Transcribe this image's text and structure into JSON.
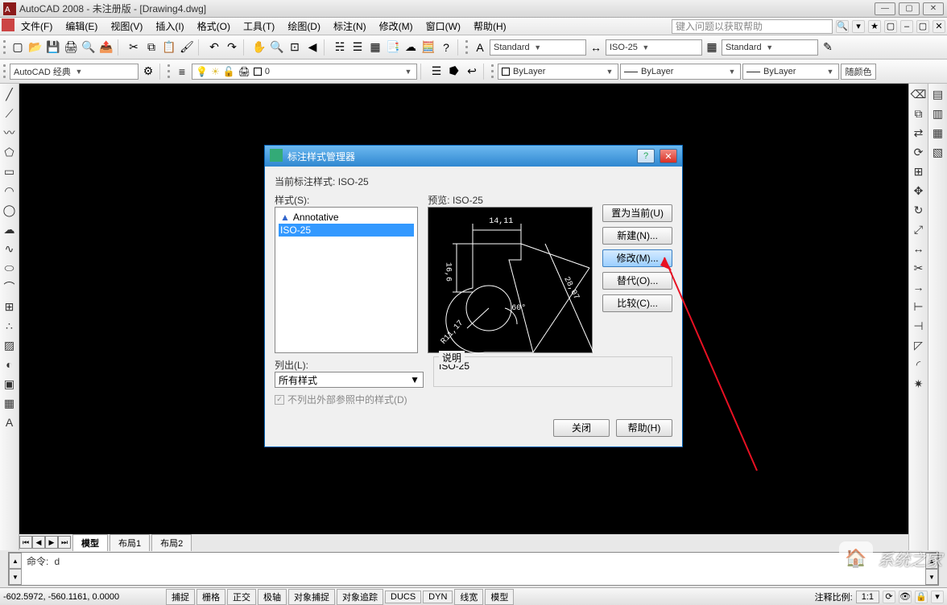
{
  "titlebar": {
    "title": "AutoCAD 2008 - 未注册版 - [Drawing4.dwg]"
  },
  "menu": {
    "items": [
      "文件(F)",
      "编辑(E)",
      "视图(V)",
      "插入(I)",
      "格式(O)",
      "工具(T)",
      "绘图(D)",
      "标注(N)",
      "修改(M)",
      "窗口(W)",
      "帮助(H)"
    ],
    "help_placeholder": "键入问题以获取帮助"
  },
  "toolbar1": {
    "workspace": "AutoCAD 经典",
    "layer": "0"
  },
  "toolbar2": {
    "std1": "Standard",
    "iso": "ISO-25",
    "std2": "Standard",
    "bylayer1": "ByLayer",
    "bylayer2": "ByLayer",
    "bylayer3": "ByLayer",
    "colorbtn": "随颜色"
  },
  "canvas_tabs": {
    "tabs": [
      "模型",
      "布局1",
      "布局2"
    ],
    "active": 0
  },
  "cmd": {
    "prompt": "命令:",
    "text": "d"
  },
  "status": {
    "coords": "-602.5972,  -560.1161, 0.0000",
    "buttons": [
      "捕捉",
      "栅格",
      "正交",
      "极轴",
      "对象捕捉",
      "对象追踪",
      "DUCS",
      "DYN",
      "线宽",
      "模型"
    ],
    "ratio_label": "注释比例:",
    "ratio": "1:1"
  },
  "dialog": {
    "title": "标注样式管理器",
    "current_label": "当前标注样式:",
    "current_value": "ISO-25",
    "styles_label": "样式(S):",
    "styles": [
      "Annotative",
      "ISO-25"
    ],
    "selected_index": 1,
    "preview_label": "预览:",
    "preview_value": "ISO-25",
    "list_label": "列出(L):",
    "list_value": "所有样式",
    "checkbox": "不列出外部参照中的样式(D)",
    "desc_label": "说明",
    "desc_value": "ISO-25",
    "buttons": {
      "set_current": "置为当前(U)",
      "new": "新建(N)...",
      "modify": "修改(M)...",
      "override": "替代(O)...",
      "compare": "比较(C)..."
    },
    "close": "关闭",
    "help": "帮助(H)",
    "dims": {
      "top": "14,11",
      "left": "16,6",
      "diag": "28,07",
      "radius": "R11,17",
      "angle": "60°"
    }
  },
  "watermark": {
    "text": "系统之家"
  }
}
